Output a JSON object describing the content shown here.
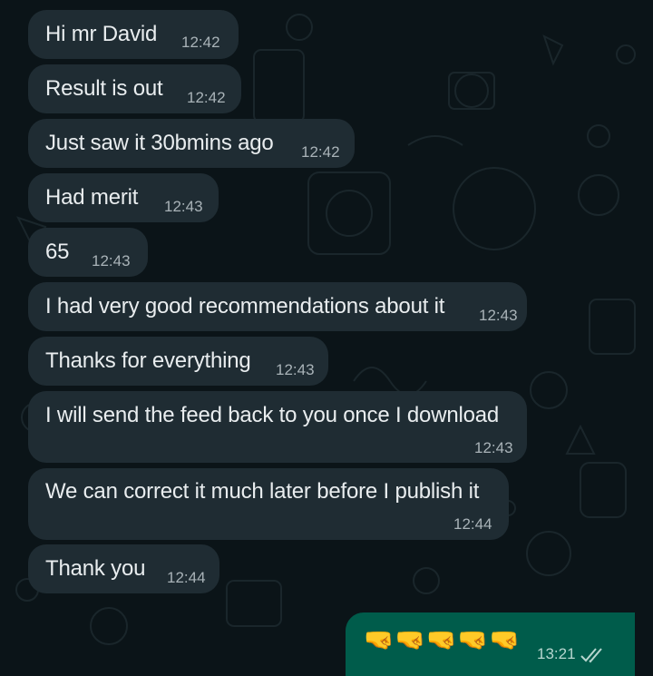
{
  "chat": {
    "incoming": [
      {
        "text": "Hi mr David",
        "time": "12:42"
      },
      {
        "text": "Result is out",
        "time": "12:42"
      },
      {
        "text": "Just saw it 30bmins ago",
        "time": "12:42"
      },
      {
        "text": "Had merit",
        "time": "12:43"
      },
      {
        "text": "65",
        "time": "12:43"
      },
      {
        "text": "I had very good recommendations about it",
        "time": "12:43"
      },
      {
        "text": "Thanks for everything",
        "time": "12:43"
      },
      {
        "text": "I will send the feed back to you once I download",
        "time": "12:43"
      },
      {
        "text": "We can correct it much later before I publish it",
        "time": "12:44"
      },
      {
        "text": "Thank you",
        "time": "12:44"
      }
    ],
    "outgoing": {
      "emoji": "🤜🤜🤜🤜🤜",
      "time": "13:21",
      "status_icon": "double-check-icon"
    }
  },
  "colors": {
    "background": "#0b1418",
    "incoming_bubble": "#1f2c33",
    "outgoing_bubble": "#005c4b",
    "text": "#e9edef",
    "timestamp": "#a9b3b8"
  }
}
